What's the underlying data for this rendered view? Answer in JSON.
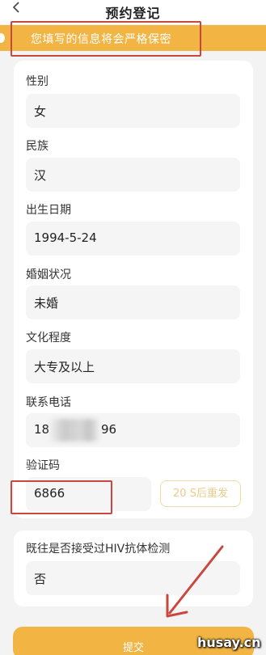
{
  "header": {
    "back_icon": "chevron-left-icon",
    "title": "预约登记"
  },
  "notice": {
    "text": "您填写的信息将会严格保密",
    "color": "#f2b544"
  },
  "form": {
    "gender": {
      "label": "性别",
      "value": "女"
    },
    "ethnicity": {
      "label": "民族",
      "value": "汉"
    },
    "birth_date": {
      "label": "出生日期",
      "value": "1994-5-24"
    },
    "marital_status": {
      "label": "婚姻状况",
      "value": "未婚"
    },
    "education": {
      "label": "文化程度",
      "value": "大专及以上"
    },
    "phone": {
      "label": "联系电话",
      "value_prefix": "18",
      "value_suffix": "96"
    },
    "verification": {
      "label": "验证码",
      "value": "6866",
      "resend_button": "20 S后重发"
    },
    "hiv_test": {
      "label": "既往是否接受过HIV抗体检测",
      "value": "否"
    }
  },
  "submit_label": "提交",
  "watermark": "husay.cn",
  "colors": {
    "accent": "#f2b544",
    "annotation": "#c9473f"
  }
}
